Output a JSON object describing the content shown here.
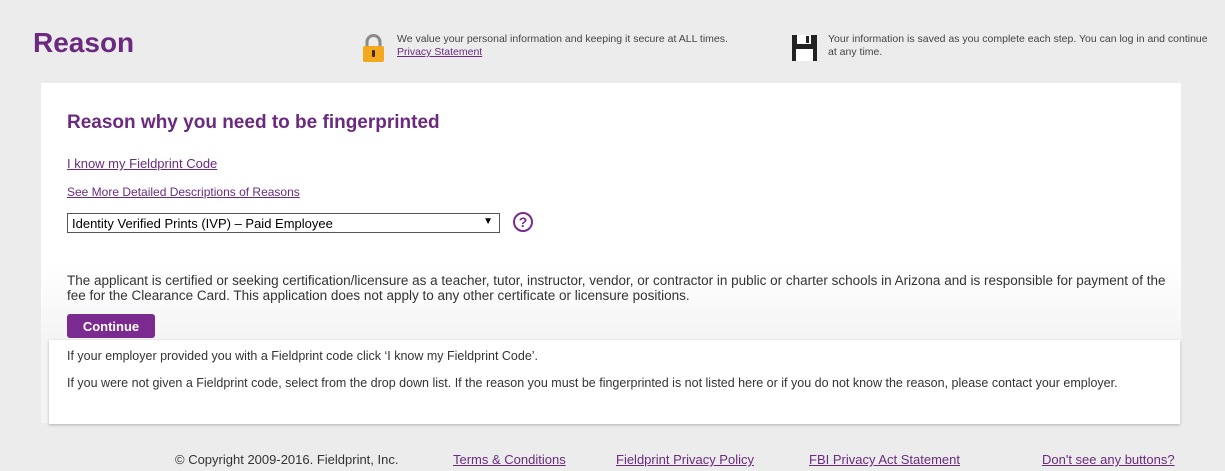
{
  "header": {
    "title": "Reason",
    "secure_notice": {
      "text": "We value your personal information and keeping it secure at ALL times.",
      "link": "Privacy Statement",
      "icon": "padlock-icon"
    },
    "saved_notice": {
      "text": "Your information is saved as you complete each step. You can log in and continue at any time.",
      "icon": "floppy-disk-icon"
    }
  },
  "main": {
    "heading": "Reason why you need to be fingerprinted",
    "link_code": "I know my Fieldprint Code",
    "link_descriptions": "See More Detailed Descriptions of Reasons",
    "reason_select": {
      "selected": "Identity Verified Prints (IVP) – Paid Employee",
      "arrow": "▼"
    },
    "help_icon": "?",
    "description": "The applicant is certified or seeking certification/licensure as a teacher, tutor, instructor, vendor, or contractor in public or charter schools in Arizona and is responsible for payment of the fee for the Clearance Card. This application does not apply to any other certificate or licensure positions.",
    "continue_label": "Continue",
    "help_line1": "If your employer provided you with a Fieldprint code click ‘I know my Fieldprint Code’.",
    "help_line2": "If you were not given a Fieldprint code, select from the drop down list. If the reason you must be fingerprinted is not listed here or if you do not know the reason, please contact your employer."
  },
  "footer": {
    "copyright": "© Copyright 2009-2016. Fieldprint, Inc.",
    "terms": "Terms & Conditions",
    "privacy_policy": "Fieldprint Privacy Policy",
    "fbi": "FBI Privacy Act Statement",
    "buttons": "Don't see any buttons?"
  },
  "colors": {
    "brand_purple": "#6b2a7f",
    "button_purple": "#7b2a8f",
    "padlock_gold": "#f4a81d"
  }
}
